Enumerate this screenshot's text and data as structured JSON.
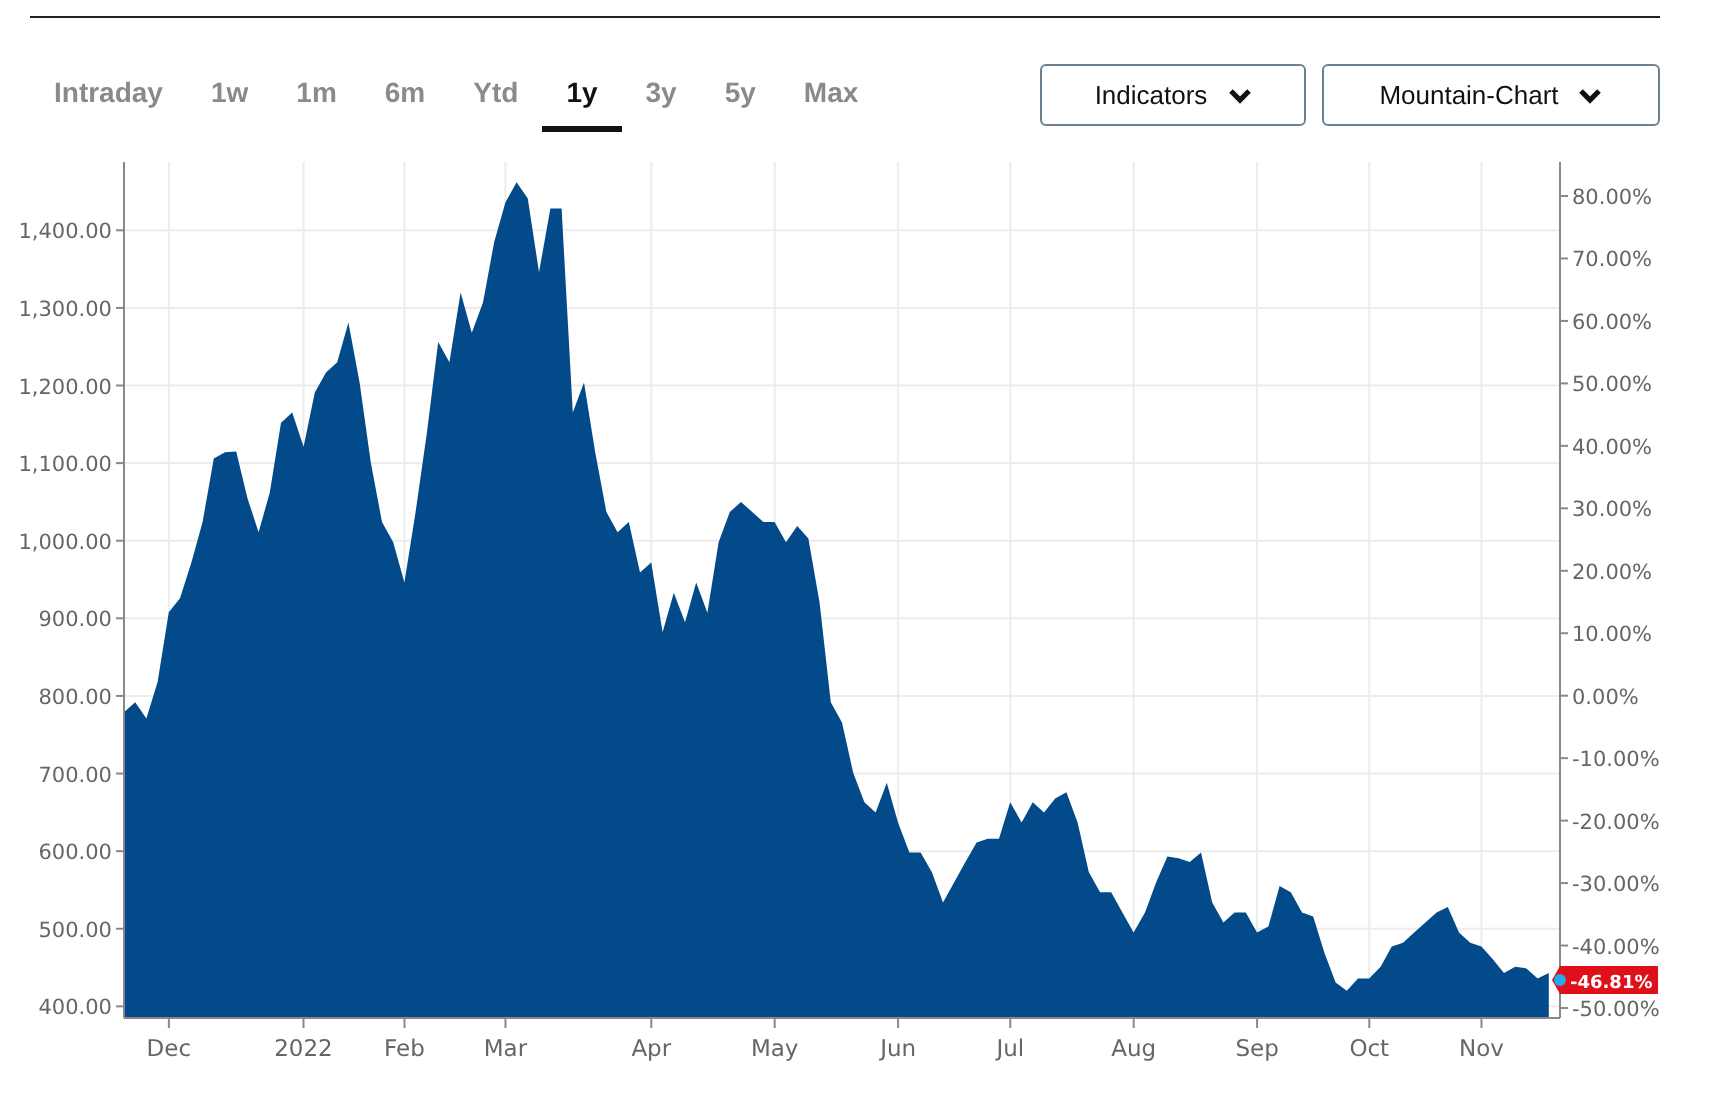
{
  "tabs": [
    {
      "label": "Intraday",
      "selected": false
    },
    {
      "label": "1w",
      "selected": false
    },
    {
      "label": "1m",
      "selected": false
    },
    {
      "label": "6m",
      "selected": false
    },
    {
      "label": "Ytd",
      "selected": false
    },
    {
      "label": "1y",
      "selected": true
    },
    {
      "label": "3y",
      "selected": false
    },
    {
      "label": "5y",
      "selected": false
    },
    {
      "label": "Max",
      "selected": false
    }
  ],
  "dropdowns": [
    {
      "label": "Indicators"
    },
    {
      "label": "Mountain-Chart"
    }
  ],
  "chart": {
    "right_axis_labels": [
      "80.00%",
      "70.00%",
      "60.00%",
      "50.00%",
      "40.00%",
      "30.00%",
      "20.00%",
      "10.00%",
      "0.00%",
      "-10.00%",
      "-20.00%",
      "-30.00%",
      "-40.00%",
      "-50.00%"
    ],
    "last_change": "-46.81%",
    "chart_data": {
      "type": "area",
      "grid": true,
      "ylim": [
        385,
        1488
      ],
      "yticks": [
        {
          "value": 400,
          "label": "400.00"
        },
        {
          "value": 500,
          "label": "500.00"
        },
        {
          "value": 600,
          "label": "600.00"
        },
        {
          "value": 700,
          "label": "700.00"
        },
        {
          "value": 800,
          "label": "800.00"
        },
        {
          "value": 900,
          "label": "900.00"
        },
        {
          "value": 1000,
          "label": "1,000.00"
        },
        {
          "value": 1100,
          "label": "1,100.00"
        },
        {
          "value": 1200,
          "label": "1,200.00"
        },
        {
          "value": 1300,
          "label": "1,300.00"
        },
        {
          "value": 1400,
          "label": "1,400.00"
        }
      ],
      "categories": [
        null,
        null,
        null,
        null,
        "Dec",
        null,
        null,
        null,
        null,
        null,
        null,
        null,
        null,
        null,
        null,
        null,
        "2022",
        null,
        null,
        null,
        null,
        null,
        null,
        null,
        null,
        "Feb",
        null,
        null,
        null,
        null,
        null,
        null,
        null,
        null,
        "Mar",
        null,
        null,
        null,
        null,
        null,
        null,
        null,
        null,
        null,
        null,
        null,
        null,
        "Apr",
        null,
        null,
        null,
        null,
        null,
        null,
        null,
        null,
        null,
        null,
        "May",
        null,
        null,
        null,
        null,
        null,
        null,
        null,
        null,
        null,
        null,
        "Jun",
        null,
        null,
        null,
        null,
        null,
        null,
        null,
        null,
        null,
        "Jul",
        null,
        null,
        null,
        null,
        null,
        null,
        null,
        null,
        null,
        null,
        "Aug",
        null,
        null,
        null,
        null,
        null,
        null,
        null,
        null,
        null,
        null,
        "Sep",
        null,
        null,
        null,
        null,
        null,
        null,
        null,
        null,
        null,
        "Oct",
        null,
        null,
        null,
        null,
        null,
        null,
        null,
        null,
        null,
        "Nov",
        null,
        null,
        null,
        null,
        null,
        null,
        null
      ],
      "series": [
        {
          "color": "#034a8a",
          "values": [
            779,
            792,
            771,
            818,
            908,
            926,
            972,
            1024,
            1106,
            1114,
            1115,
            1055,
            1011,
            1062,
            1152,
            1165,
            1121,
            1191,
            1217,
            1230,
            1281,
            1204,
            1101,
            1024,
            998,
            946,
            1037,
            1140,
            1256,
            1230,
            1320,
            1268,
            1307,
            1385,
            1436,
            1462,
            1441,
            1346,
            1428,
            1428,
            1165,
            1204,
            1114,
            1037,
            1011,
            1024,
            959,
            972,
            882,
            933,
            895,
            946,
            907,
            998,
            1037,
            1050,
            1037,
            1024,
            1024,
            998,
            1019,
            1003,
            920,
            792,
            766,
            701,
            663,
            650,
            688,
            637,
            598,
            598,
            573,
            534,
            560,
            586,
            611,
            616,
            616,
            663,
            637,
            663,
            650,
            668,
            676,
            637,
            573,
            547,
            547,
            521,
            495,
            521,
            560,
            593,
            591,
            586,
            598,
            534,
            508,
            521,
            521,
            495,
            503,
            555,
            547,
            521,
            516,
            469,
            431,
            420,
            436,
            436,
            451,
            477,
            482,
            495,
            508,
            521,
            528,
            495,
            482,
            477,
            461,
            443,
            451,
            449,
            436,
            443,
            null
          ]
        }
      ]
    }
  }
}
